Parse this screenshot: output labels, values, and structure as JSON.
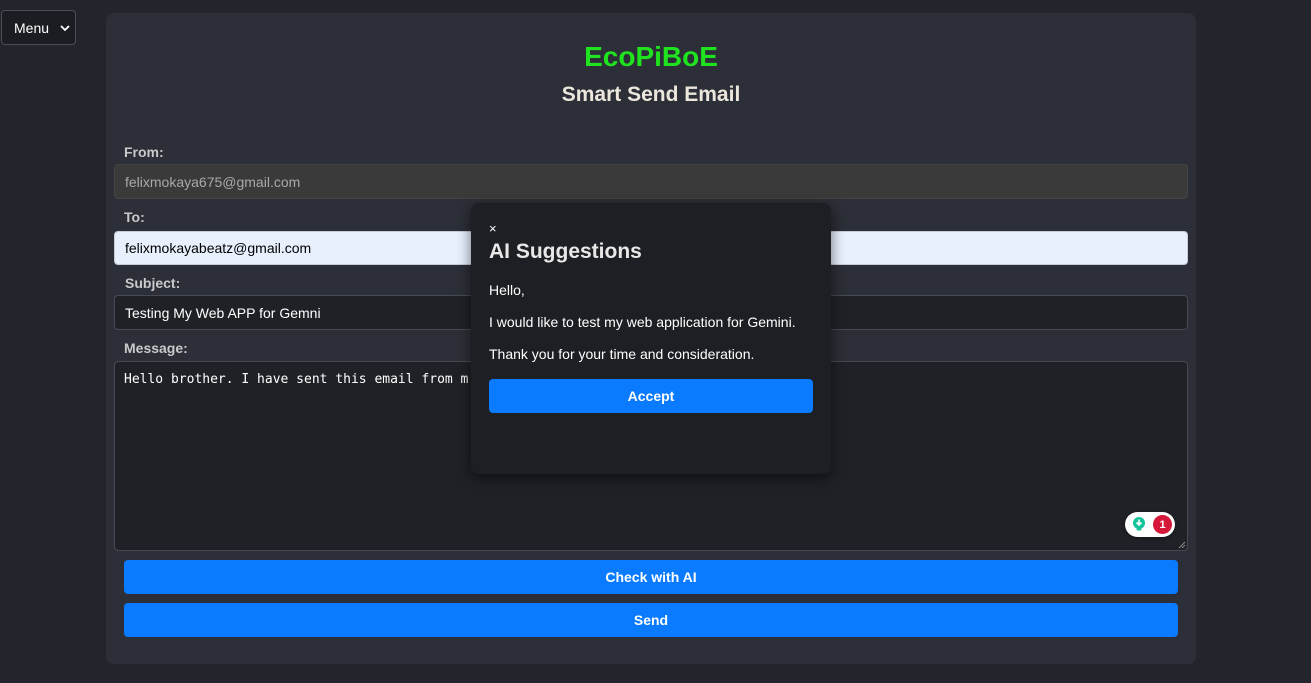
{
  "menu": {
    "label": "Menu"
  },
  "app": {
    "brand": "EcoPiBoE",
    "title": "Smart Send Email"
  },
  "form": {
    "from_label": "From:",
    "from_value": "felixmokaya675@gmail.com",
    "to_label": "To:",
    "to_value": "felixmokayabeatz@gmail.com",
    "subject_label": "Subject:",
    "subject_value": "Testing My Web APP for Gemni",
    "message_label": "Message:",
    "message_value": "Hello brother. I have sent this email from m",
    "grammar_issue_count": "1",
    "check_button": "Check with AI",
    "send_button": "Send"
  },
  "modal": {
    "close": "×",
    "title": "AI Suggestions",
    "suggestions": [
      "Hello,",
      "I would like to test my web application for Gemini.",
      "Thank you for your time and consideration."
    ],
    "accept_button": "Accept"
  },
  "colors": {
    "brand": "#1fe31f",
    "accent": "#0a7bff",
    "background": "#22252b",
    "card": "#2c2f37",
    "badge": "#d5183a"
  }
}
